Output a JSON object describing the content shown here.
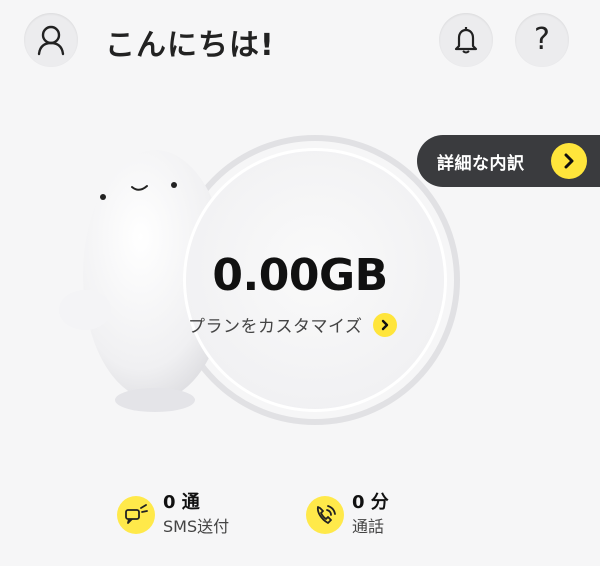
{
  "header": {
    "greeting": "こんにちは!",
    "help_label": "?"
  },
  "details": {
    "label": "詳細な内訳"
  },
  "usage": {
    "amount": "0.00GB",
    "customize_label": "プランをカスタマイズ"
  },
  "stats": {
    "sms": {
      "value": "0 通",
      "label": "SMS送付"
    },
    "call": {
      "value": "0 分",
      "label": "通話"
    }
  },
  "colors": {
    "accent": "#ffe53b",
    "pill": "#3a3b3e",
    "background": "#f6f6f7"
  },
  "icons": [
    "profile-icon",
    "bell-icon",
    "help-icon",
    "chevron-right-icon",
    "sms-icon",
    "phone-icon"
  ]
}
